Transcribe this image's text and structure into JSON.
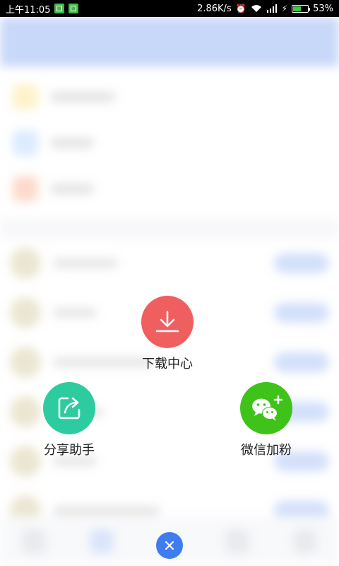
{
  "status_bar": {
    "time": "上午11:05",
    "speed": "2.86K/s",
    "battery_percent": "53%",
    "battery_level": 0.53,
    "icons": [
      "app-notification-icon",
      "app-notification-icon-2",
      "alarm-icon",
      "wifi-icon",
      "signal-icon",
      "charging-icon",
      "battery-icon"
    ]
  },
  "actions": {
    "download": {
      "label": "下载中心",
      "icon": "download-icon",
      "color": "#f05f5f"
    },
    "share": {
      "label": "分享助手",
      "icon": "share-icon",
      "color": "#2dcca0"
    },
    "wechat": {
      "label": "微信加粉",
      "icon": "wechat-add-icon",
      "color": "#3fc21a"
    }
  },
  "close": {
    "icon": "close-icon",
    "color": "#3f7cf0"
  },
  "colors": {
    "header_bg": "#97b5f2",
    "accent": "#3f7cf0"
  }
}
